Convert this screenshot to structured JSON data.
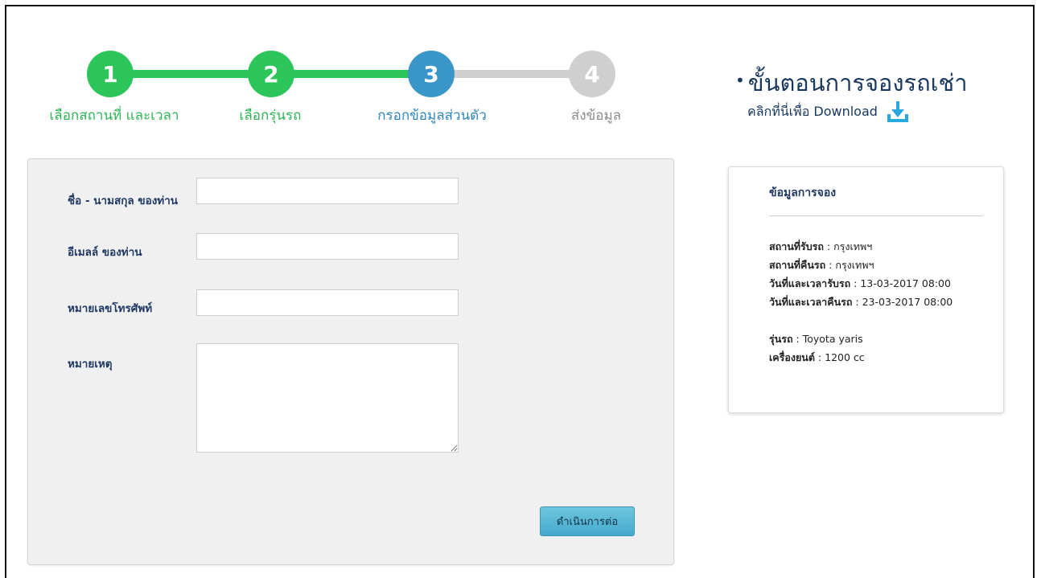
{
  "stepper": {
    "steps": [
      {
        "number": "1",
        "label": "เลือกสถานที่ และเวลา",
        "color": "#2cc55a",
        "state": "done"
      },
      {
        "number": "2",
        "label": "เลือกรุ่นรถ",
        "color": "#2cc55a",
        "state": "done"
      },
      {
        "number": "3",
        "label": "กรอกข้อมูลส่วนตัว",
        "color": "#3a96c9",
        "state": "active"
      },
      {
        "number": "4",
        "label": "ส่งข้อมูล",
        "color": "#cfcfcf",
        "state": "pending"
      }
    ]
  },
  "process": {
    "bullet": "•",
    "title": "ขั้นตอนการจองรถเช่า",
    "download_text": "คลิกที่นี่เพื่อ Download",
    "download_icon": "download-icon"
  },
  "form": {
    "name_label": "ชื่อ - นามสกุล ของท่าน",
    "name_value": "",
    "email_label": "อีเมลล์ ของท่าน",
    "email_value": "",
    "phone_label": "หมายเลขโทรศัพท์",
    "phone_value": "",
    "note_label": "หมายเหตุ",
    "note_value": "",
    "continue_label": "ดำเนินการต่อ"
  },
  "booking": {
    "title": "ข้อมูลการจอง",
    "rows": [
      {
        "key": "สถานที่รับรถ",
        "value": "กรุงเทพฯ"
      },
      {
        "key": "สถานที่คืนรถ",
        "value": "กรุงเทพฯ"
      },
      {
        "key": "วันที่และเวลารับรถ",
        "value": "13-03-2017 08:00"
      },
      {
        "key": "วันที่และเวลาคืนรถ",
        "value": "23-03-2017 08:00"
      },
      {
        "key": "รุ่นรถ",
        "value": "Toyota yaris"
      },
      {
        "key": "เครื่องยนต์",
        "value": "1200 cc"
      }
    ],
    "separator": " : "
  },
  "colors": {
    "accent_green": "#2cc55a",
    "accent_blue": "#3a96c9",
    "pending_gray": "#cfcfcf",
    "text_navy": "#1f3864"
  }
}
